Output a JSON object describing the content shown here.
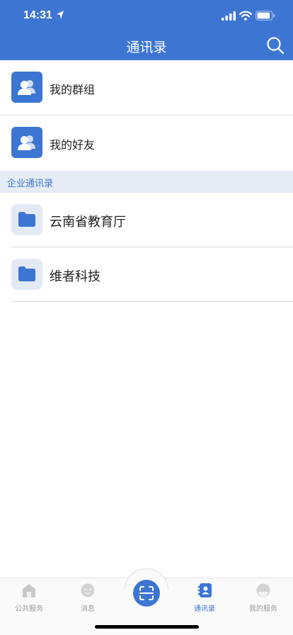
{
  "status_bar": {
    "time": "14:31"
  },
  "header": {
    "title": "通讯录"
  },
  "quick_entries": [
    {
      "label": "我的群组",
      "icon": "group-icon"
    },
    {
      "label": "我的好友",
      "icon": "friends-icon"
    }
  ],
  "section": {
    "label": "企业通讯录"
  },
  "organizations": [
    {
      "label": "云南省教育厅",
      "icon": "folder-icon"
    },
    {
      "label": "维者科技",
      "icon": "folder-icon"
    }
  ],
  "tabbar": {
    "tabs": [
      {
        "label": "公共服务",
        "icon": "building-icon",
        "active": false
      },
      {
        "label": "消息",
        "icon": "chat-icon",
        "active": false
      },
      {
        "label": "通讯录",
        "icon": "contacts-icon",
        "active": true
      },
      {
        "label": "我的服务",
        "icon": "profile-icon",
        "active": false
      }
    ],
    "center_icon": "scan-icon"
  },
  "colors": {
    "primary": "#3d76d2",
    "section_bg": "#e5ecf6",
    "folder_bg": "#e3eaf5",
    "tab_inactive": "#9a9a9a"
  }
}
